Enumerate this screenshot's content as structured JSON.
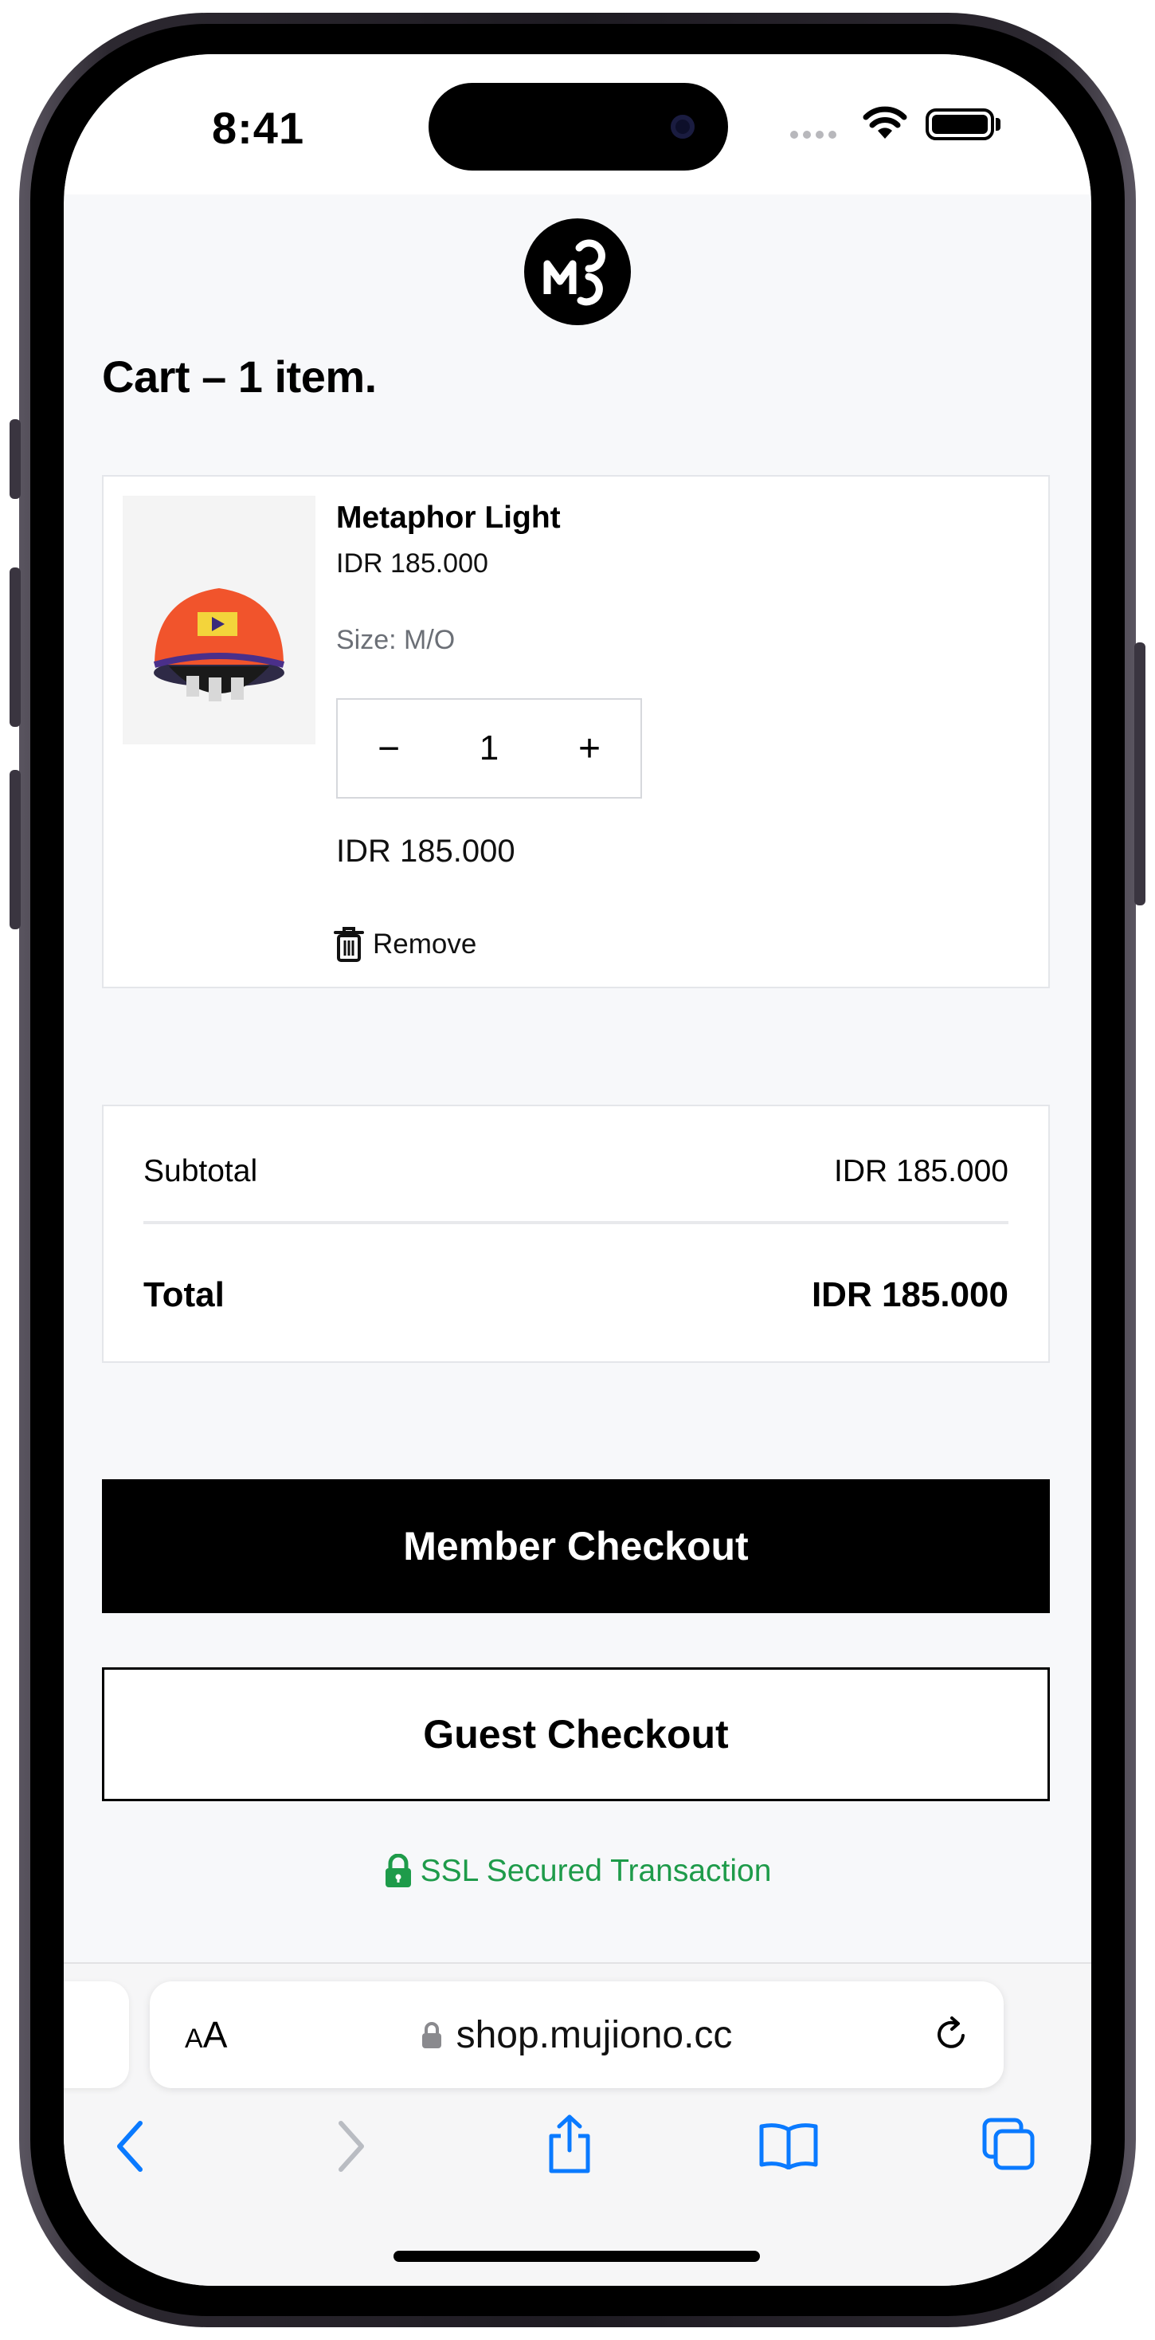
{
  "status_bar": {
    "time": "8:41"
  },
  "brand": {
    "logo_text": "MC"
  },
  "page": {
    "title": "Cart – 1 item."
  },
  "cart_item": {
    "name": "Metaphor Light",
    "price": "IDR 185.000",
    "size": "Size: M/O",
    "quantity": "1",
    "decrease_symbol": "−",
    "increase_symbol": "+",
    "line_total": "IDR 185.000",
    "remove_label": "Remove"
  },
  "summary": {
    "subtotal_label": "Subtotal",
    "subtotal_value": "IDR 185.000",
    "total_label": "Total",
    "total_value": "IDR 185.000"
  },
  "actions": {
    "member_checkout": "Member Checkout",
    "guest_checkout": "Guest Checkout",
    "ssl_note": "SSL Secured Transaction"
  },
  "browser": {
    "text_size_small": "A",
    "text_size_large": "A",
    "url": "shop.mujiono.cc",
    "toolbar": [
      "back-icon",
      "forward-icon",
      "share-icon",
      "bookmarks-icon",
      "tabs-icon"
    ]
  },
  "colors": {
    "accent_green": "#1e9b4a",
    "primary": "#000000",
    "page_bg": "#f7f8fa",
    "ios_blue": "#0a7aff"
  }
}
